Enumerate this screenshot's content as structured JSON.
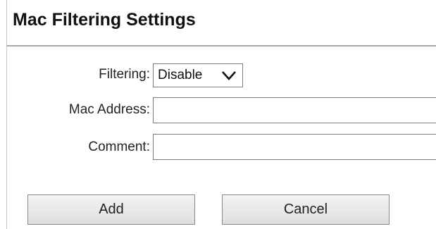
{
  "header": {
    "title": "Mac Filtering Settings"
  },
  "form": {
    "filtering": {
      "label": "Filtering:",
      "selected_value": "Disable"
    },
    "mac_address": {
      "label": "Mac Address:",
      "value": "",
      "placeholder": ""
    },
    "comment": {
      "label": "Comment:",
      "value": "",
      "placeholder": ""
    }
  },
  "buttons": {
    "add_label": "Add",
    "cancel_label": "Cancel"
  },
  "icons": {
    "dropdown": "chevron-down-icon"
  }
}
